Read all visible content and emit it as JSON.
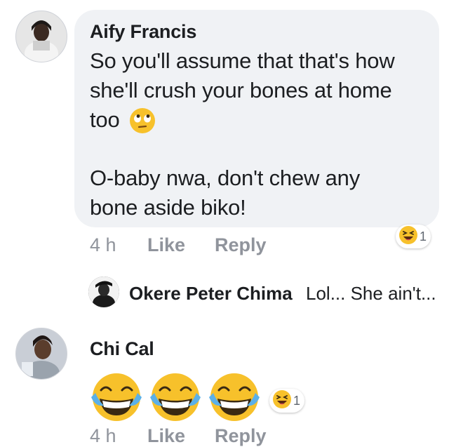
{
  "comments": [
    {
      "author": "Aify Francis",
      "lines": [
        "So you'll assume that that's how",
        "she'll crush your bones at home",
        "too",
        "O-baby nwa, don't chew any",
        "bone aside biko!"
      ],
      "inline_emoji": "face-with-rolling-eyes-icon",
      "time": "4 h",
      "like_label": "Like",
      "reply_label": "Reply",
      "reaction_count": "1",
      "reaction_icon": "haha-reaction-icon",
      "reply_preview": {
        "author": "Okere Peter Chima",
        "text": "Lol... She ain't..."
      }
    },
    {
      "author": "Chi Cal",
      "emoji_count": 3,
      "emoji_icon": "face-with-tears-of-joy-icon",
      "reaction_count": "1",
      "reaction_icon": "haha-reaction-icon",
      "time_partial": "4 h",
      "like_partial": "Like",
      "reply_partial": "Reply"
    }
  ],
  "colors": {
    "bubble": "#f0f2f5",
    "meta_text": "#90949c",
    "emoji_yellow": "#f7c12b"
  }
}
